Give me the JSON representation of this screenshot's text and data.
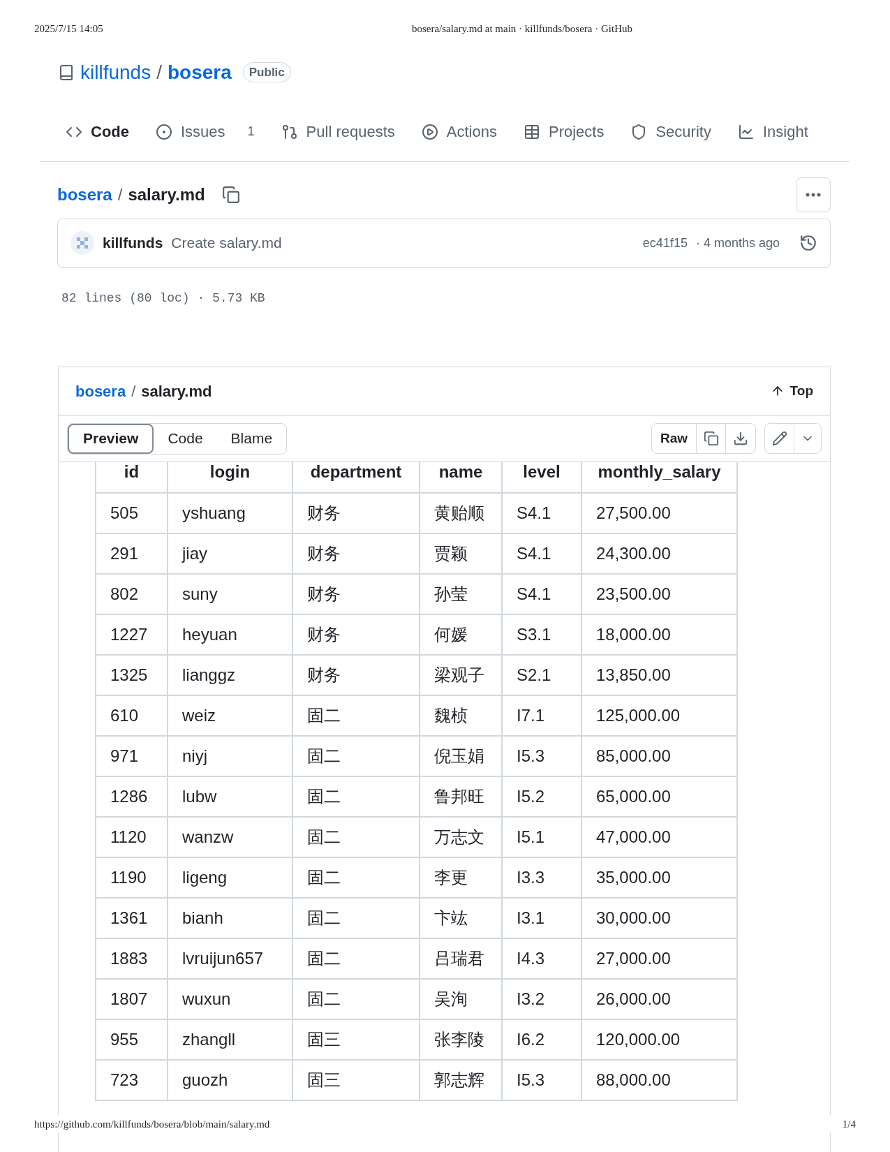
{
  "print_header": {
    "date": "2025/7/15 14:05",
    "title": "bosera/salary.md at main · killfunds/bosera · GitHub"
  },
  "repo": {
    "owner": "killfunds",
    "separator": "/",
    "name": "bosera",
    "visibility": "Public"
  },
  "nav": [
    {
      "label": "Code",
      "selected": true
    },
    {
      "label": "Issues",
      "selected": false,
      "count": "1"
    },
    {
      "label": "Pull requests",
      "selected": false
    },
    {
      "label": "Actions",
      "selected": false
    },
    {
      "label": "Projects",
      "selected": false
    },
    {
      "label": "Security",
      "selected": false
    },
    {
      "label": "Insight",
      "selected": false
    }
  ],
  "breadcrumb": {
    "repo": "bosera",
    "separator": "/",
    "file": "salary.md"
  },
  "commit": {
    "author": "killfunds",
    "message": "Create salary.md",
    "sha": "ec41f15",
    "age": "· 4 months ago"
  },
  "file_info": "82 lines (80 loc) · 5.73 KB",
  "file_header": {
    "repo": "bosera",
    "separator": "/",
    "file": "salary.md",
    "top": "Top"
  },
  "view_tabs": [
    {
      "label": "Preview",
      "selected": true
    },
    {
      "label": "Code",
      "selected": false
    },
    {
      "label": "Blame",
      "selected": false
    }
  ],
  "raw_button": "Raw",
  "table": {
    "columns": [
      "id",
      "login",
      "department",
      "name",
      "level",
      "monthly_salary"
    ],
    "rows": [
      [
        "505",
        "yshuang",
        "财务",
        "黄贻顺",
        "S4.1",
        "27,500.00"
      ],
      [
        "291",
        "jiay",
        "财务",
        "贾颖",
        "S4.1",
        "24,300.00"
      ],
      [
        "802",
        "suny",
        "财务",
        "孙莹",
        "S4.1",
        "23,500.00"
      ],
      [
        "1227",
        "heyuan",
        "财务",
        "何媛",
        "S3.1",
        "18,000.00"
      ],
      [
        "1325",
        "lianggz",
        "财务",
        "梁观子",
        "S2.1",
        "13,850.00"
      ],
      [
        "610",
        "weiz",
        "固二",
        "魏桢",
        "I7.1",
        "125,000.00"
      ],
      [
        "971",
        "niyj",
        "固二",
        "倪玉娟",
        "I5.3",
        "85,000.00"
      ],
      [
        "1286",
        "lubw",
        "固二",
        "鲁邦旺",
        "I5.2",
        "65,000.00"
      ],
      [
        "1120",
        "wanzw",
        "固二",
        "万志文",
        "I5.1",
        "47,000.00"
      ],
      [
        "1190",
        "ligeng",
        "固二",
        "李更",
        "I3.3",
        "35,000.00"
      ],
      [
        "1361",
        "bianh",
        "固二",
        "卞竑",
        "I3.1",
        "30,000.00"
      ],
      [
        "1883",
        "lvruijun657",
        "固二",
        "吕瑞君",
        "I4.3",
        "27,000.00"
      ],
      [
        "1807",
        "wuxun",
        "固二",
        "吴洵",
        "I3.2",
        "26,000.00"
      ],
      [
        "955",
        "zhangll",
        "固三",
        "张李陵",
        "I6.2",
        "120,000.00"
      ],
      [
        "723",
        "guozh",
        "固三",
        "郭志辉",
        "I5.3",
        "88,000.00"
      ]
    ]
  },
  "print_footer": {
    "url": "https://github.com/killfunds/bosera/blob/main/salary.md",
    "page": "1/4"
  }
}
